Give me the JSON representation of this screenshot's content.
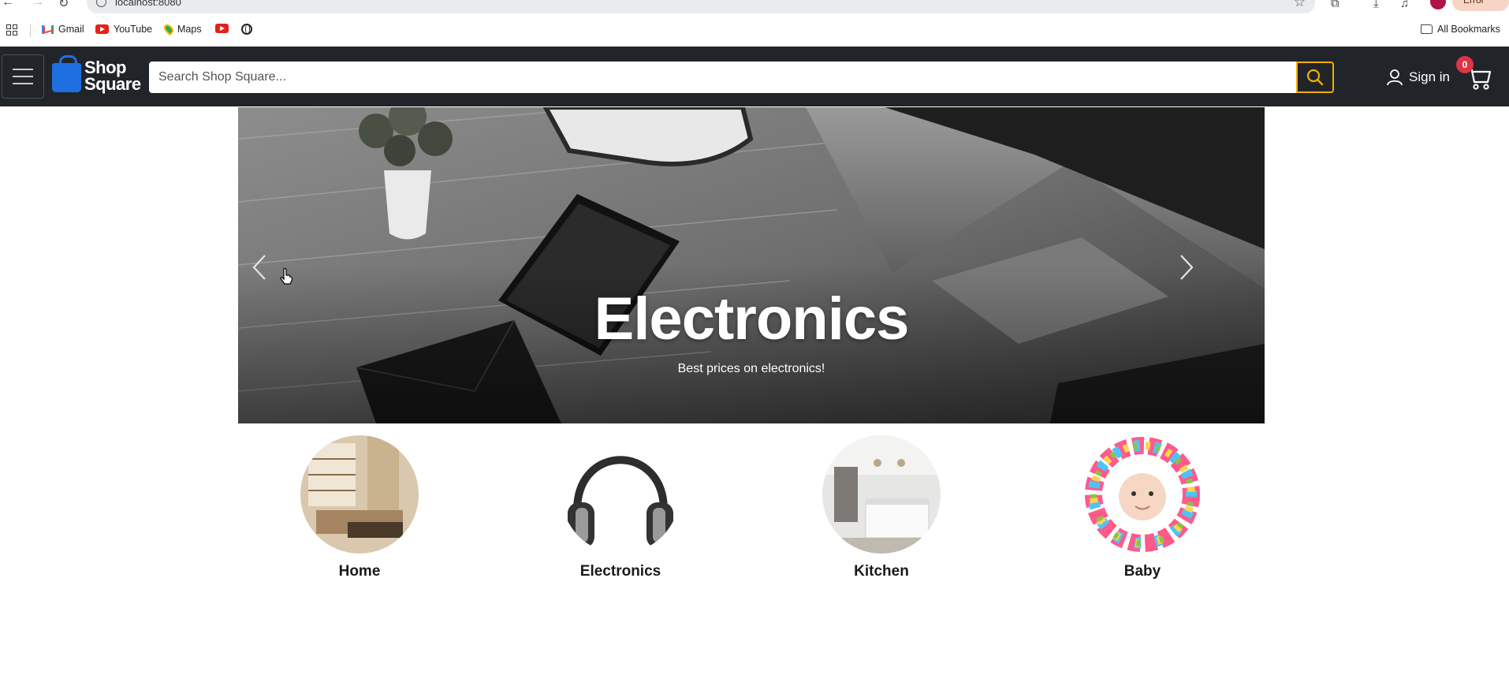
{
  "browser": {
    "url": "localhost:8080",
    "profile_status": "Error"
  },
  "bookmarks": {
    "items": [
      {
        "label": "Gmail",
        "icon": "gmail-icon"
      },
      {
        "label": "YouTube",
        "icon": "youtube-icon"
      },
      {
        "label": "Maps",
        "icon": "maps-icon"
      }
    ],
    "all_bookmarks": "All Bookmarks"
  },
  "header": {
    "logo_line1": "Shop",
    "logo_line2": "Square",
    "search_placeholder": "Search Shop Square...",
    "signin_label": "Sign in",
    "cart_count": "0",
    "brand_color": "#212529",
    "accent_color": "#f0b000"
  },
  "carousel": {
    "title": "Electronics",
    "subtitle": "Best prices on electronics!"
  },
  "categories": [
    {
      "label": "Home"
    },
    {
      "label": "Electronics"
    },
    {
      "label": "Kitchen"
    },
    {
      "label": "Baby"
    }
  ]
}
